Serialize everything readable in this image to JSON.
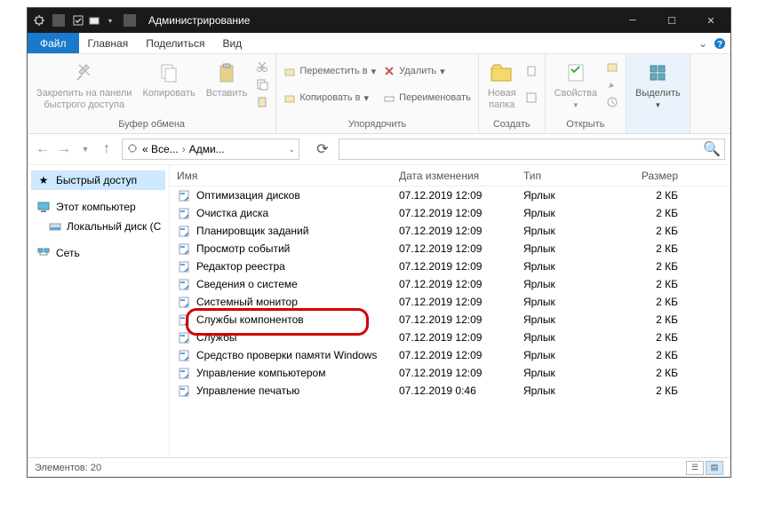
{
  "titlebar": {
    "title": "Администрирование"
  },
  "tabs": {
    "file": "Файл",
    "home": "Главная",
    "share": "Поделиться",
    "view": "Вид"
  },
  "ribbon": {
    "pin": "Закрепить на панели\nбыстрого доступа",
    "copy": "Копировать",
    "paste": "Вставить",
    "clipboard": "Буфер обмена",
    "moveto": "Переместить в",
    "copyto": "Копировать в",
    "delete": "Удалить",
    "rename": "Переименовать",
    "organize": "Упорядочить",
    "newfolder": "Новая\nпапка",
    "new": "Создать",
    "properties": "Свойства",
    "open": "Открыть",
    "select": "Выделить"
  },
  "breadcrumb": {
    "seg1": "« Все...",
    "seg2": "Адми..."
  },
  "sidebar": {
    "quick": "Быстрый доступ",
    "pc": "Этот компьютер",
    "disk": "Локальный диск (C",
    "network": "Сеть"
  },
  "columns": {
    "name": "Имя",
    "date": "Дата изменения",
    "type": "Тип",
    "size": "Размер"
  },
  "files": [
    {
      "name": "Оптимизация дисков",
      "date": "07.12.2019 12:09",
      "type": "Ярлык",
      "size": "2 КБ"
    },
    {
      "name": "Очистка диска",
      "date": "07.12.2019 12:09",
      "type": "Ярлык",
      "size": "2 КБ"
    },
    {
      "name": "Планировщик заданий",
      "date": "07.12.2019 12:09",
      "type": "Ярлык",
      "size": "2 КБ"
    },
    {
      "name": "Просмотр событий",
      "date": "07.12.2019 12:09",
      "type": "Ярлык",
      "size": "2 КБ"
    },
    {
      "name": "Редактор реестра",
      "date": "07.12.2019 12:09",
      "type": "Ярлык",
      "size": "2 КБ"
    },
    {
      "name": "Сведения о системе",
      "date": "07.12.2019 12:09",
      "type": "Ярлык",
      "size": "2 КБ"
    },
    {
      "name": "Системный монитор",
      "date": "07.12.2019 12:09",
      "type": "Ярлык",
      "size": "2 КБ"
    },
    {
      "name": "Службы компонентов",
      "date": "07.12.2019 12:09",
      "type": "Ярлык",
      "size": "2 КБ",
      "hl": true
    },
    {
      "name": "Службы",
      "date": "07.12.2019 12:09",
      "type": "Ярлык",
      "size": "2 КБ"
    },
    {
      "name": "Средство проверки памяти Windows",
      "date": "07.12.2019 12:09",
      "type": "Ярлык",
      "size": "2 КБ"
    },
    {
      "name": "Управление компьютером",
      "date": "07.12.2019 12:09",
      "type": "Ярлык",
      "size": "2 КБ"
    },
    {
      "name": "Управление печатью",
      "date": "07.12.2019 0:46",
      "type": "Ярлык",
      "size": "2 КБ"
    }
  ],
  "status": {
    "count": "Элементов: 20"
  }
}
